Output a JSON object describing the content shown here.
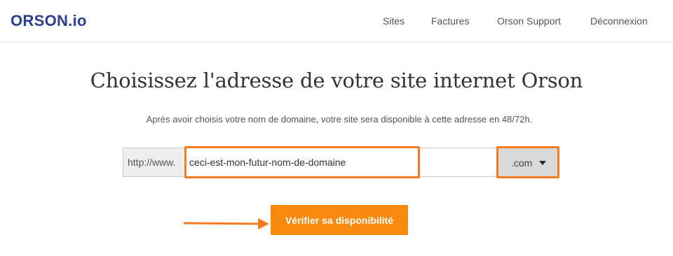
{
  "header": {
    "logo": "ORSON.io",
    "nav": [
      {
        "label": "Sites"
      },
      {
        "label": "Factures"
      },
      {
        "label": "Orson Support"
      },
      {
        "label": "Déconnexion"
      }
    ]
  },
  "main": {
    "title": "Choisissez l'adresse de votre site internet Orson",
    "subtitle": "Après avoir choisis votre nom de domaine, votre site sera disponible à cette adresse en 48/72h.",
    "domain_prefix": "http://www.",
    "domain_input_value": "ceci-est-mon-futur-nom-de-domaine",
    "tld_selected": ".com",
    "check_button_label": "Vérifier sa disponibilité"
  },
  "colors": {
    "accent": "#f7890f",
    "highlight_border": "#f47b20",
    "logo": "#2c3e91"
  },
  "icons": {
    "dropdown": "caret-down-icon",
    "annotation": "arrow-right-icon"
  }
}
